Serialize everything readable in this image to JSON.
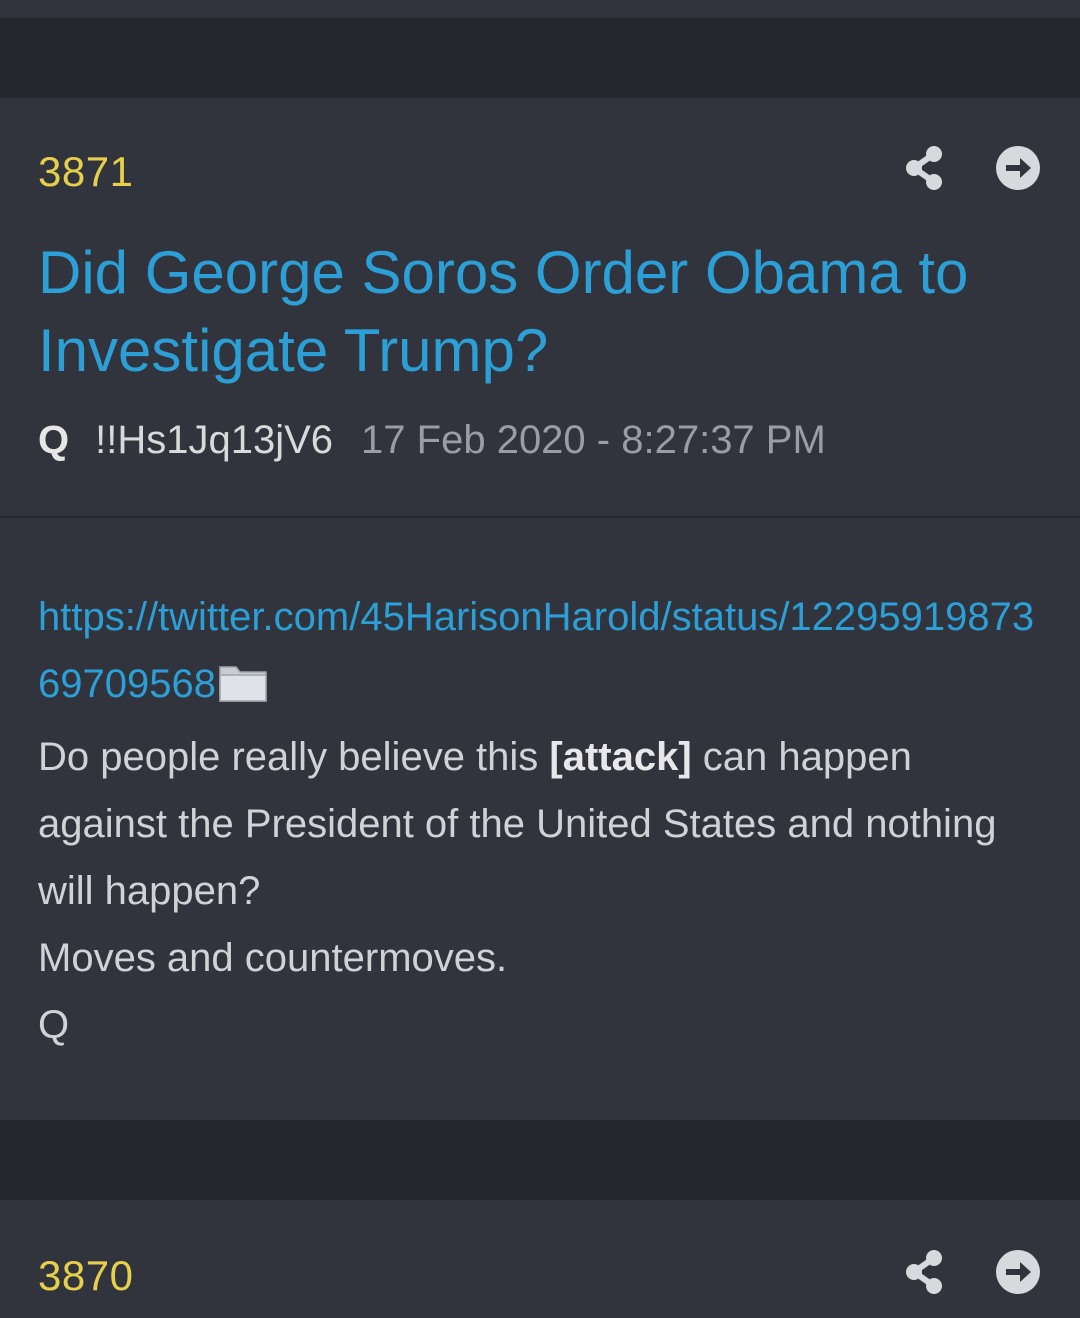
{
  "posts": [
    {
      "number": "3871",
      "title": "Did George Soros Order Obama to Investigate Trump?",
      "author": "Q",
      "tripcode": "!!Hs1Jq13jV6",
      "date": "17 Feb 2020 - 8:27:37 PM",
      "link": "https://twitter.com/45HarisonHarold/status/1229591987369709568",
      "body_part1": "Do people really believe this ",
      "body_emphasis": "[attack]",
      "body_part2": " can happen against the President of the United States and nothing will happen?",
      "body_line2": "Moves and countermoves.",
      "body_line3": "Q",
      "icons": {
        "share": "share-icon",
        "open": "arrow-right-circle-icon",
        "attachment": "folder-icon"
      }
    },
    {
      "number": "3870",
      "icons": {
        "share": "share-icon",
        "open": "arrow-right-circle-icon"
      }
    }
  ],
  "colors": {
    "background": "#2d3038",
    "post_background": "#31343c",
    "number": "#e6cf4a",
    "title": "#2b9fd6",
    "link": "#2b9fd6",
    "body_text": "#d0d2d6",
    "meta_date": "#9a9da3"
  }
}
